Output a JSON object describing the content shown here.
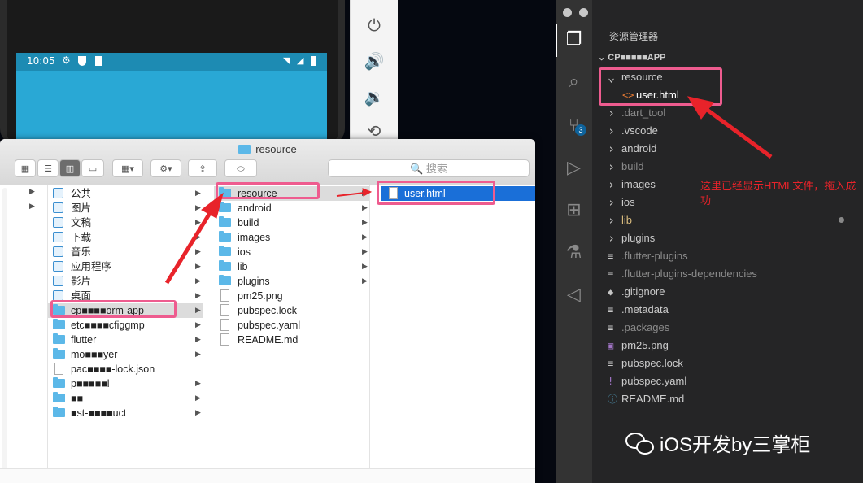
{
  "phone": {
    "time": "10:05",
    "status_icons": [
      "gear-icon",
      "shield-icon",
      "sdcard-icon"
    ],
    "right_icons": [
      "wifi-icon",
      "signal-icon",
      "battery-icon"
    ]
  },
  "emulator": {
    "buttons": [
      "power-icon",
      "volume-up-icon",
      "volume-down-icon",
      "rotate-icon"
    ]
  },
  "finder": {
    "title": "resource",
    "search_placeholder": "搜索",
    "sidebar": [
      "公共",
      "图片",
      "文稿",
      "下载",
      "音乐",
      "应用程序",
      "影片",
      "桌面"
    ],
    "col1_files": [
      "cp■■■■orm-app",
      "etc■■■■cfiggmp",
      "flutter",
      "mo■■■yer",
      "pac■■■■-lock.json",
      "p■■■■■l",
      "■■",
      "■st-■■■■uct"
    ],
    "col2": [
      "resource",
      "android",
      "build",
      "images",
      "ios",
      "lib",
      "plugins",
      "pm25.png",
      "pubspec.lock",
      "pubspec.yaml",
      "README.md"
    ],
    "col3": [
      "user.html"
    ]
  },
  "vscode": {
    "explorer_title": "资源管理器",
    "project_title": "CP■■■■■APP",
    "scm_badge": "3",
    "tree": [
      {
        "label": "resource",
        "kind": "folder-open",
        "depth": 1
      },
      {
        "label": "user.html",
        "kind": "html",
        "depth": 2
      },
      {
        "label": ".dart_tool",
        "kind": "folder",
        "depth": 1,
        "dim": true
      },
      {
        "label": ".vscode",
        "kind": "folder",
        "depth": 1
      },
      {
        "label": "android",
        "kind": "folder",
        "depth": 1
      },
      {
        "label": "build",
        "kind": "folder",
        "depth": 1,
        "dim": true
      },
      {
        "label": "images",
        "kind": "folder",
        "depth": 1
      },
      {
        "label": "ios",
        "kind": "folder",
        "depth": 1
      },
      {
        "label": "lib",
        "kind": "folder",
        "depth": 1,
        "yellow": true
      },
      {
        "label": "plugins",
        "kind": "folder",
        "depth": 1
      },
      {
        "label": ".flutter-plugins",
        "kind": "file",
        "depth": 1,
        "dim": true
      },
      {
        "label": ".flutter-plugins-dependencies",
        "kind": "file",
        "depth": 1,
        "dim": true
      },
      {
        "label": ".gitignore",
        "kind": "git",
        "depth": 1
      },
      {
        "label": ".metadata",
        "kind": "file",
        "depth": 1
      },
      {
        "label": ".packages",
        "kind": "file",
        "depth": 1,
        "dim": true
      },
      {
        "label": "pm25.png",
        "kind": "image",
        "depth": 1
      },
      {
        "label": "pubspec.lock",
        "kind": "file",
        "depth": 1
      },
      {
        "label": "pubspec.yaml",
        "kind": "yaml",
        "depth": 1
      },
      {
        "label": "README.md",
        "kind": "info",
        "depth": 1
      }
    ]
  },
  "annotation": {
    "text": "这里已经显示HTML文件，拖入成功"
  },
  "watermark": "iOS开发by三掌柜",
  "colors": {
    "highlight": "#ee5c8f",
    "arrow": "#e8232a",
    "vscode_bg": "#252526"
  }
}
